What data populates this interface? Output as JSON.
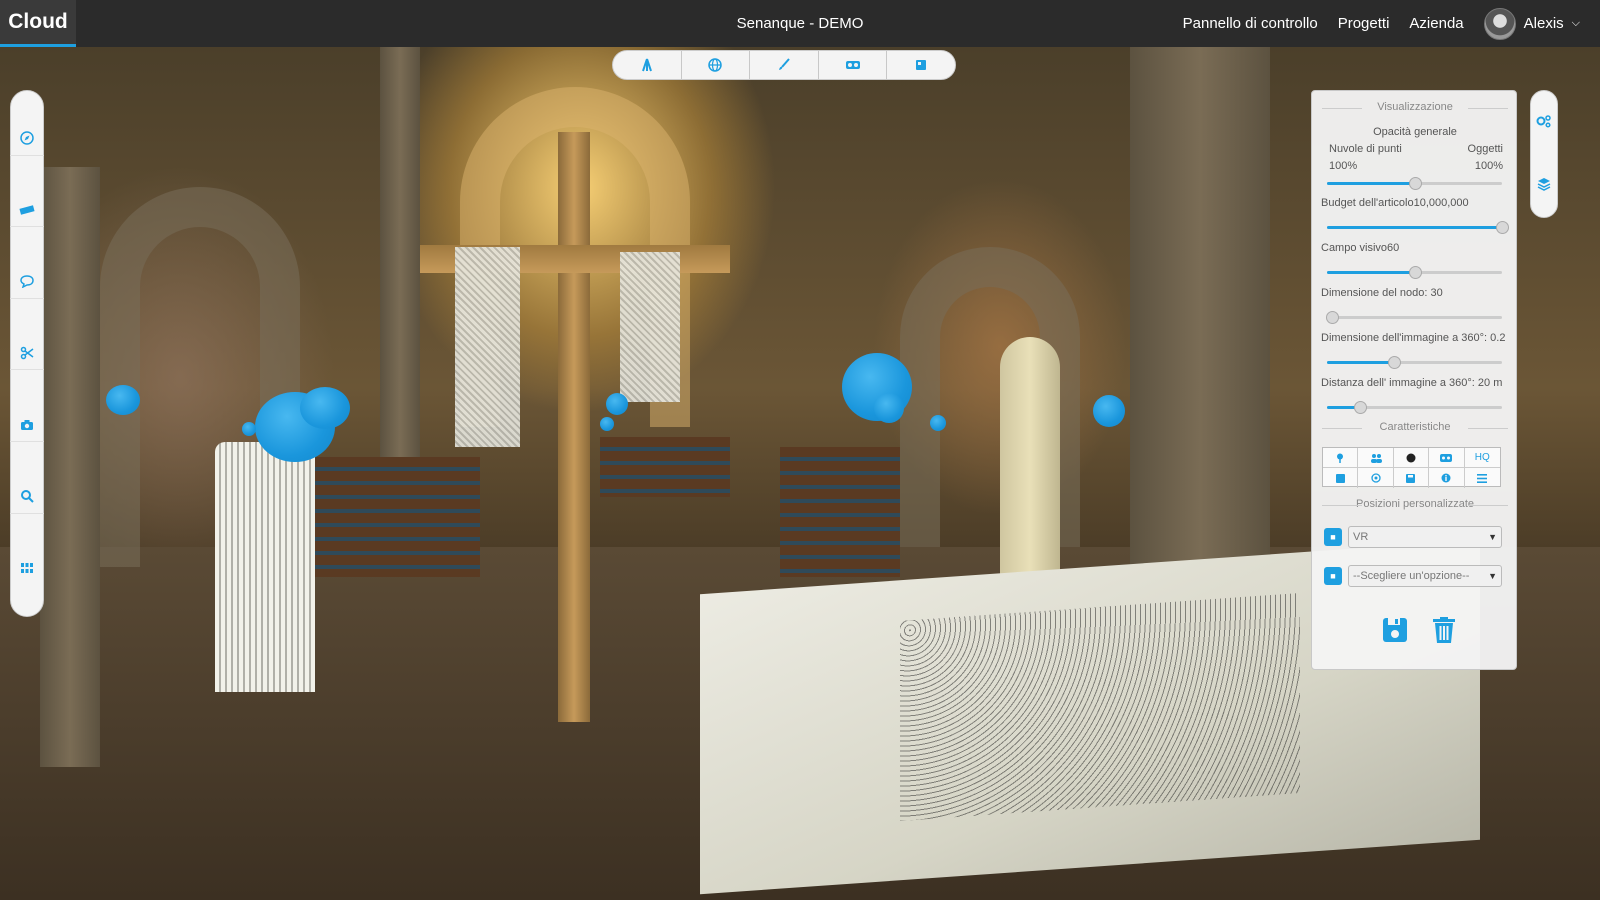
{
  "header": {
    "brand": "Cloud",
    "project_title": "Senanque - DEMO",
    "nav": [
      "Pannello di controllo",
      "Progetti",
      "Azienda"
    ],
    "user_name": "Alexis"
  },
  "toolbar": {
    "icons": [
      "tripod-icon",
      "globe-icon",
      "brush-icon",
      "vr-headset-icon",
      "cube-icon"
    ]
  },
  "left_sidebar": {
    "icons": [
      "compass-icon",
      "ruler-icon",
      "comment-icon",
      "scissors-icon",
      "camera-icon",
      "search-icon",
      "grid-icon"
    ]
  },
  "right_sidebar": {
    "icons": [
      "settings-icon",
      "layers-icon"
    ]
  },
  "panel": {
    "visualization_title": "Visualizzazione",
    "opacity_title": "Opacità generale",
    "point_clouds_label": "Nuvole di punti",
    "objects_label": "Oggetti",
    "point_clouds_value": "100%",
    "objects_value": "100%",
    "opacity_slider": 0.5,
    "budget_label": "Budget dell'articolo10,000,000",
    "budget_slider": 1.0,
    "fov_label": "Campo visivo60",
    "fov_slider": 0.5,
    "node_size_label": "Dimensione del nodo: 30",
    "node_size_slider": 0.03,
    "image360_size_label": "Dimensione dell'immagine a 360°: 0.2",
    "image360_size_slider": 0.38,
    "image360_distance_label": "Distanza dell' immagine a 360°: 20 m",
    "image360_distance_slider": 0.19,
    "features_title": "Caratteristiche",
    "features": [
      "pin-icon",
      "users-icon",
      "circle-icon",
      "vr-icon",
      "HQ",
      "box-icon",
      "target-icon",
      "save-icon",
      "info-icon",
      "list-icon"
    ],
    "positions_title": "Posizioni personalizzate",
    "position_select_1": "VR",
    "position_select_2": "--Scegliere un'opzione--"
  },
  "colors": {
    "accent": "#1e9fe0",
    "topbar": "#2b2b2b"
  }
}
